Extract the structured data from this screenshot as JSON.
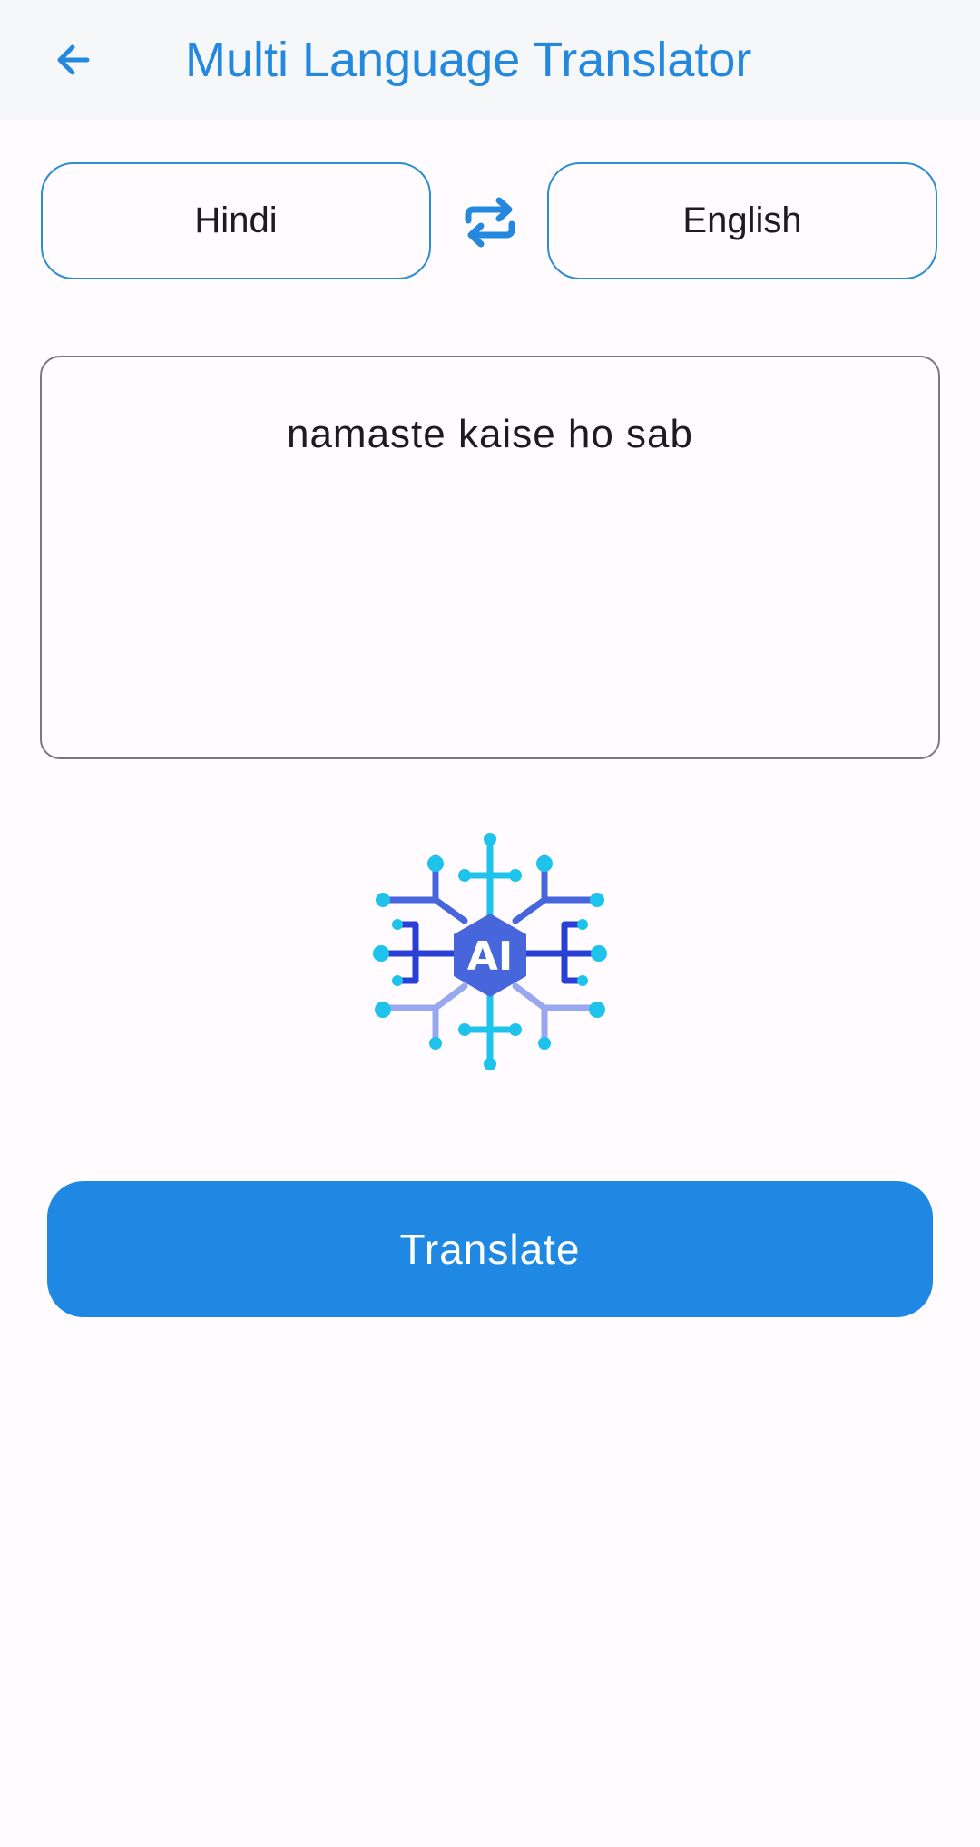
{
  "app_bar": {
    "title": "Multi Language Translator",
    "back_icon": "arrow-left-icon"
  },
  "languages": {
    "source": "Hindi",
    "target": "English",
    "swap_icon": "swap-arrows-icon"
  },
  "input": {
    "value": "namaste kaise ho sab"
  },
  "logo": {
    "icon": "ai-circuit-icon",
    "text": "AI"
  },
  "actions": {
    "translate_label": "Translate"
  },
  "colors": {
    "accent": "#2489de",
    "button": "#1f88e3",
    "appbar_bg": "#f6f7f9",
    "page_bg": "#fffbfe",
    "border": "#2a8fd2"
  }
}
